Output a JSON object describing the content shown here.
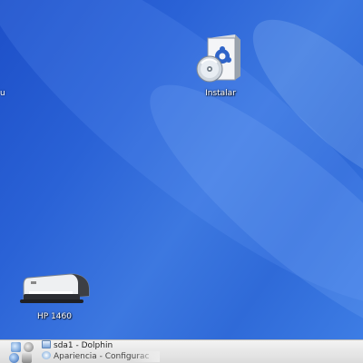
{
  "desktop": {
    "edge_label": "u",
    "icons": [
      {
        "label": "Instalar",
        "icon": "install-package-icon"
      },
      {
        "label": "HP 1460",
        "icon": "printer-icon"
      }
    ]
  },
  "taskbar": {
    "tray_icons": [
      "network-icon",
      "clock-icon",
      "browser-icon",
      "settings-icon"
    ],
    "tasks": [
      {
        "label": "sda1 - Dolphin",
        "icon": "folder-icon"
      },
      {
        "label": "Apariencia - Configurac",
        "icon": "appearance-icon"
      }
    ]
  },
  "colors": {
    "desktop_background": "#2a62d6",
    "taskbar_background": "#e6e6e6"
  }
}
